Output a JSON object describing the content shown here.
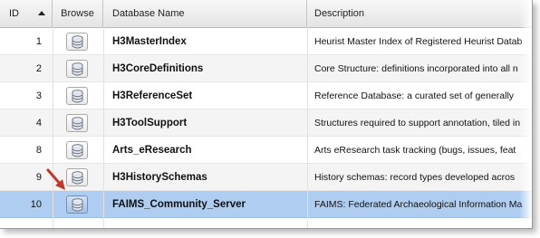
{
  "header": {
    "id": "ID",
    "browse": "Browse",
    "name": "Database Name",
    "description": "Description"
  },
  "rows": [
    {
      "id": "1",
      "name": "H3MasterIndex",
      "description": "Heurist Master Index of Registered Heurist Datab"
    },
    {
      "id": "2",
      "name": "H3CoreDefinitions",
      "description": "Core Structure: definitions incorporated into all n"
    },
    {
      "id": "3",
      "name": "H3ReferenceSet",
      "description": "Reference Database: a curated set of generally"
    },
    {
      "id": "4",
      "name": "H3ToolSupport",
      "description": "Structures required to support annotation, tiled in"
    },
    {
      "id": "8",
      "name": "Arts_eResearch",
      "description": "Arts eResearch task tracking (bugs, issues, feat"
    },
    {
      "id": "9",
      "name": "H3HistorySchemas",
      "description": "History schemas: record types developed acros"
    },
    {
      "id": "10",
      "name": "FAIMS_Community_Server",
      "description": "FAIMS: Federated Archaeological Information Ma"
    }
  ],
  "selected_row": "10",
  "icons": {
    "sort": "sort-ascending-icon",
    "browse": "database-icon",
    "pointer": "red-arrow-annotation"
  },
  "colors": {
    "selected_row": "#aecdf0",
    "arrow": "#c0392b"
  }
}
